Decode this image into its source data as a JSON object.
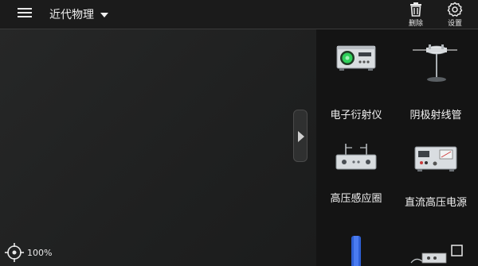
{
  "header": {
    "category": "近代物理",
    "delete_label": "删除",
    "settings_label": "设置"
  },
  "palette": {
    "items": [
      {
        "name": "电子衍射仪",
        "icon": "electron-diffractometer-icon"
      },
      {
        "name": "阴极射线管",
        "icon": "cathode-ray-tube-icon"
      },
      {
        "name": "高压感应圈",
        "icon": "induction-coil-icon"
      },
      {
        "name": "直流高压电源",
        "icon": "dc-hv-power-supply-icon"
      }
    ]
  },
  "status": {
    "zoom": "100%"
  },
  "colors": {
    "background": "#1c1d1d",
    "panel": "#141414",
    "accent_green": "#2fd05a"
  }
}
